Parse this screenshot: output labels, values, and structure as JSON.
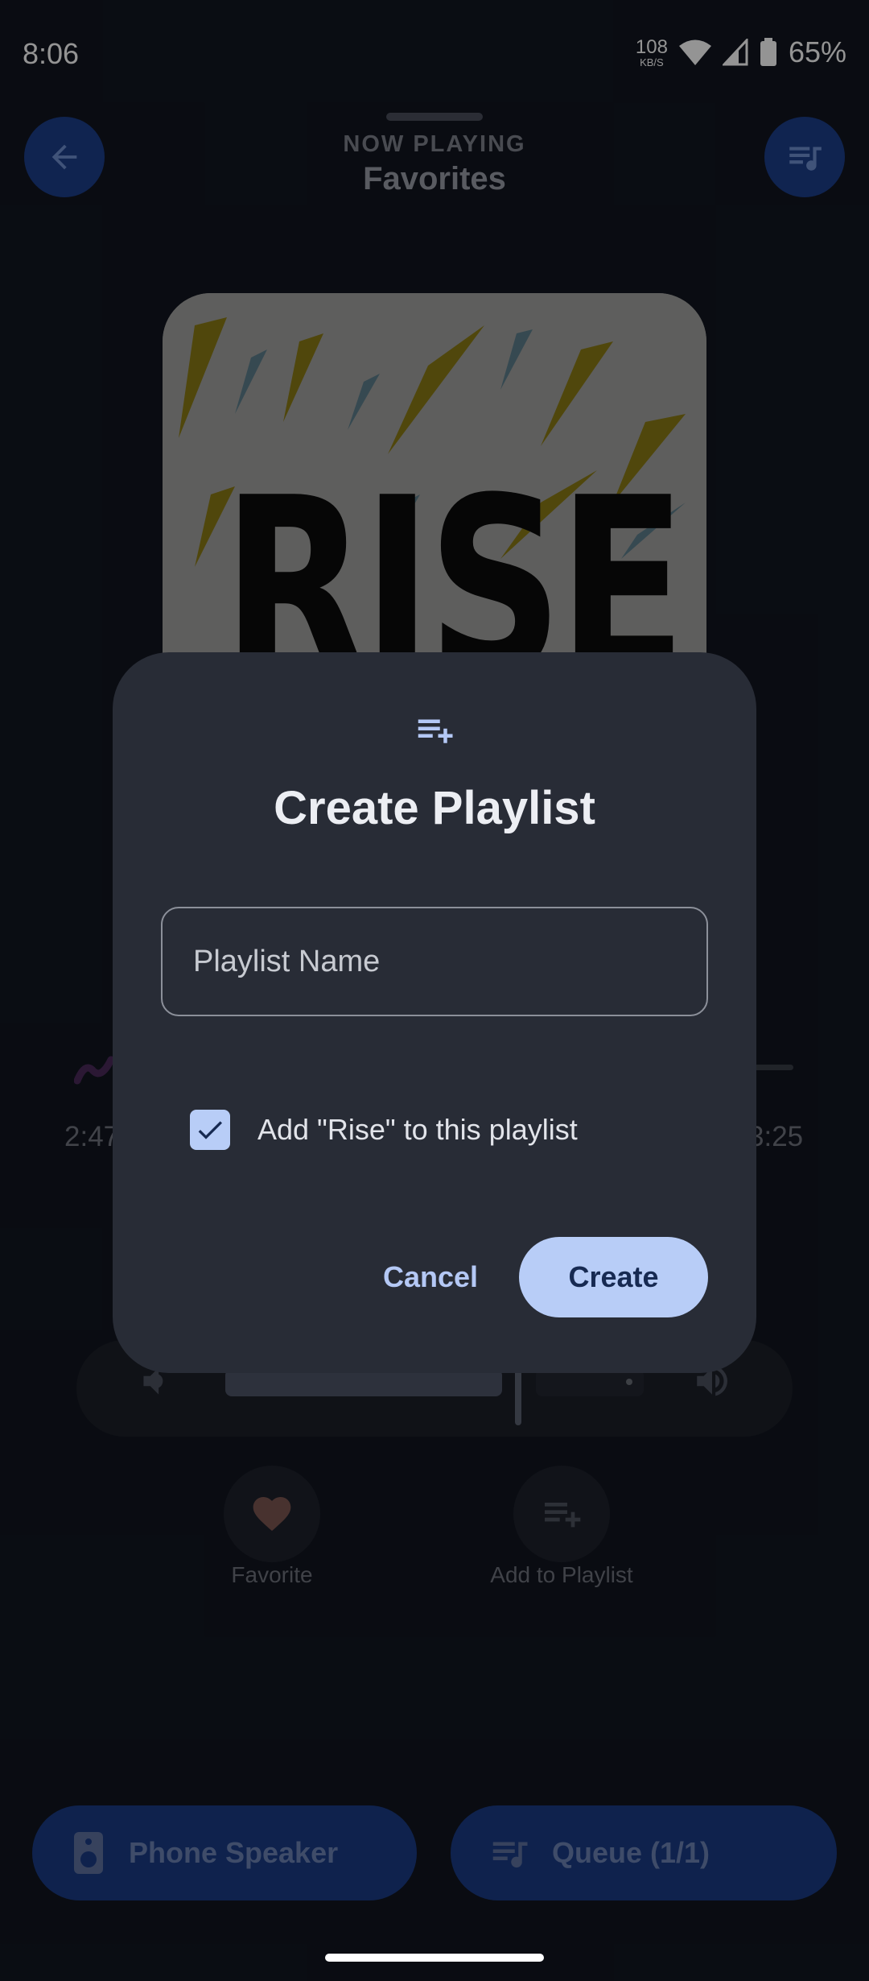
{
  "status_bar": {
    "time": "8:06",
    "net_speed_value": "108",
    "net_speed_unit": "KB/S",
    "battery": "65%"
  },
  "header": {
    "now_playing_label": "NOW PLAYING",
    "playlist_title": "Favorites"
  },
  "album_art": {
    "text": "RISE"
  },
  "progress": {
    "elapsed": "2:47",
    "total": "3:25"
  },
  "actions": {
    "favorite_label": "Favorite",
    "add_to_playlist_label": "Add to Playlist"
  },
  "bottom": {
    "speaker_label": "Phone Speaker",
    "queue_label": "Queue (1/1)"
  },
  "dialog": {
    "title": "Create Playlist",
    "input_placeholder": "Playlist Name",
    "input_value": "",
    "checkbox_label": "Add \"Rise\" to this playlist",
    "checkbox_checked": true,
    "cancel_label": "Cancel",
    "create_label": "Create"
  },
  "colors": {
    "background": "#121620",
    "dialog_background": "#282c36",
    "accent": "#b8cdf7",
    "primary_button_dark": "#1c3e8a"
  }
}
